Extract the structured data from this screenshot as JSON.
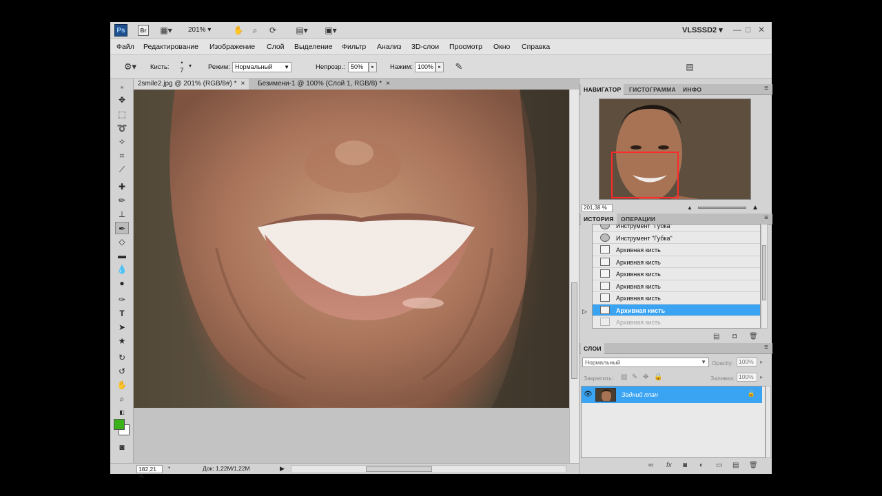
{
  "titlebar": {
    "app_badge": "Ps",
    "bridge_badge": "Br",
    "zoom": "201%",
    "workspace": "VLSSSD2",
    "minimize": "—",
    "maximize": "□",
    "close": "✕"
  },
  "menu": [
    "Файл",
    "Редактирование",
    "Изображение",
    "Слой",
    "Выделение",
    "Фильтр",
    "Анализ",
    "3D-слои",
    "Просмотр",
    "Окно",
    "Справка"
  ],
  "options": {
    "brush_label": "Кисть:",
    "brush_size": "7",
    "mode_label": "Режим:",
    "mode_value": "Нормальный",
    "opacity_label": "Непрозр.:",
    "opacity_value": "50%",
    "flow_label": "Нажим:",
    "flow_value": "100%"
  },
  "doc_tabs": [
    {
      "label": "2smile2.jpg @ 201% (RGB/8#) *",
      "close": "×"
    },
    {
      "label": "Безимени-1 @ 100% (Слой 1, RGB/8) *",
      "close": "×"
    }
  ],
  "status": {
    "zoom": "182,21 %",
    "doc_info": "Док: 1,22M/1,22M"
  },
  "navigator": {
    "tabs": [
      "НАВИГАТОР",
      "ГИСТОГРАММА",
      "ИНФО"
    ],
    "zoom": "201,38 %"
  },
  "history": {
    "tabs": [
      "ИСТОРИЯ",
      "ОПЕРАЦИИ"
    ],
    "items": [
      {
        "label": "Инструмент \"Губка\"",
        "icon": "sponge-icon"
      },
      {
        "label": "Инструмент \"Губка\"",
        "icon": "sponge-icon"
      },
      {
        "label": "Архивная кисть",
        "icon": "history-brush-icon"
      },
      {
        "label": "Архивная кисть",
        "icon": "history-brush-icon"
      },
      {
        "label": "Архивная кисть",
        "icon": "history-brush-icon"
      },
      {
        "label": "Архивная кисть",
        "icon": "history-brush-icon"
      },
      {
        "label": "Архивная кисть",
        "icon": "history-brush-icon"
      },
      {
        "label": "Архивная кисть",
        "icon": "history-brush-icon"
      },
      {
        "label": "Архивная кисть",
        "icon": "history-brush-icon"
      }
    ],
    "selected_index": 7
  },
  "layers": {
    "tab": "СЛОИ",
    "blend_mode": "Нормальный",
    "opacity_label": "Opacity:",
    "opacity_value": "100%",
    "lock_label": "Закрепить:",
    "fill_label": "Заливка:",
    "fill_value": "100%",
    "layer_name": "Задний план"
  },
  "colors": {
    "foreground": "#3bb11a",
    "background": "#ffffff",
    "selection": "#3aa3f2",
    "nav_view_box": "#ff2a2a"
  }
}
